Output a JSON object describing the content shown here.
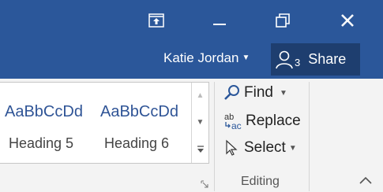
{
  "window": {
    "restore_icon": "ribbon-display-options-icon",
    "minimize_icon": "minimize-icon",
    "maximize_icon": "restore-window-icon",
    "close_icon": "close-icon"
  },
  "account": {
    "user_name": "Katie Jordan",
    "share_count": "3",
    "share_label": "Share",
    "share_icon": "people-icon"
  },
  "styles_gallery": {
    "styles": [
      {
        "sample": "AaBbCcDd",
        "name": "Heading 5"
      },
      {
        "sample": "AaBbCcDd",
        "name": "Heading 6"
      }
    ],
    "scroll_up_icon": "scroll-up-icon",
    "scroll_down_icon": "scroll-down-icon",
    "more_icon": "gallery-more-icon",
    "launcher_icon": "dialog-launcher-icon"
  },
  "editing": {
    "group_label": "Editing",
    "find_label": "Find",
    "replace_label": "Replace",
    "select_label": "Select",
    "find_icon": "search-icon",
    "replace_icon": "replace-icon",
    "select_icon": "cursor-icon"
  },
  "ribbon": {
    "collapse_icon": "collapse-ribbon-icon"
  },
  "colors": {
    "titlebar": "#2b579a",
    "share_button": "#1e3e6f",
    "style_text": "#2f5496",
    "ribbon_bg": "#f3f3f3"
  }
}
